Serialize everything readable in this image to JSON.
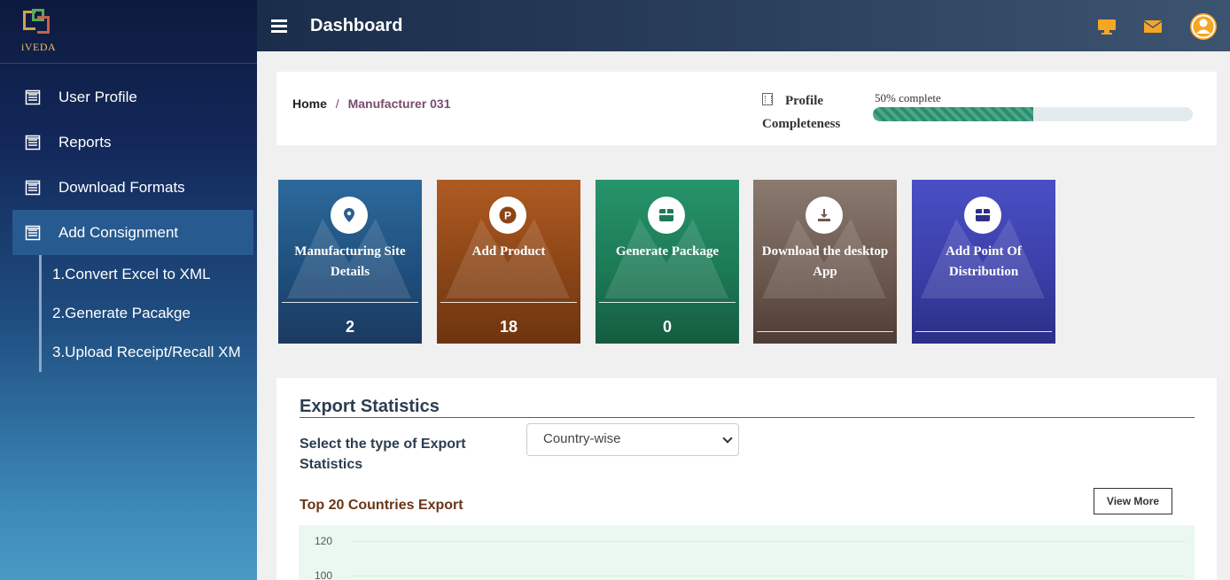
{
  "logo": {
    "text": "iVEDA"
  },
  "sidebar": {
    "items": [
      {
        "label": "User Profile",
        "icon": "form-icon"
      },
      {
        "label": "Reports",
        "icon": "form-icon"
      },
      {
        "label": "Download Formats",
        "icon": "form-icon"
      },
      {
        "label": "Add Consignment",
        "icon": "form-icon",
        "active": true
      }
    ],
    "submenu": [
      {
        "label": "1.Convert Excel to XML"
      },
      {
        "label": "2.Generate Pacakge"
      },
      {
        "label": "3.Upload Receipt/Recall XM"
      }
    ]
  },
  "header": {
    "title": "Dashboard",
    "icons": [
      "desktop-icon",
      "mail-icon",
      "user-avatar-icon"
    ],
    "accent": "#f5a623"
  },
  "breadcrumb": {
    "home": "Home",
    "separator": "/",
    "current": "Manufacturer 031"
  },
  "profile": {
    "label": "Profile Completeness",
    "progress_text": "50% complete",
    "progress_value": 0.5
  },
  "tiles": [
    {
      "label": "Manufacturing Site Details",
      "count": "2",
      "icon": "map-pin-icon",
      "color": "#2b5f8f"
    },
    {
      "label": "Add Product",
      "count": "18",
      "icon": "product-p-icon",
      "color": "#8a4516"
    },
    {
      "label": "Generate Package",
      "count": "0",
      "icon": "package-icon",
      "color": "#1c7a55"
    },
    {
      "label": "Download the desktop App",
      "count": "",
      "icon": "download-icon",
      "color": "#6d5a50"
    },
    {
      "label": "Add Point Of Distribution",
      "count": "",
      "icon": "package-icon",
      "color": "#3b3fa8"
    }
  ],
  "export": {
    "title": "Export Statistics",
    "select_label": "Select the type of Export Statistics",
    "select_value": "Country-wise",
    "chart_title": "Top 20 Countries Export",
    "view_more": "View More",
    "y_ticks": [
      "120",
      "100"
    ]
  }
}
